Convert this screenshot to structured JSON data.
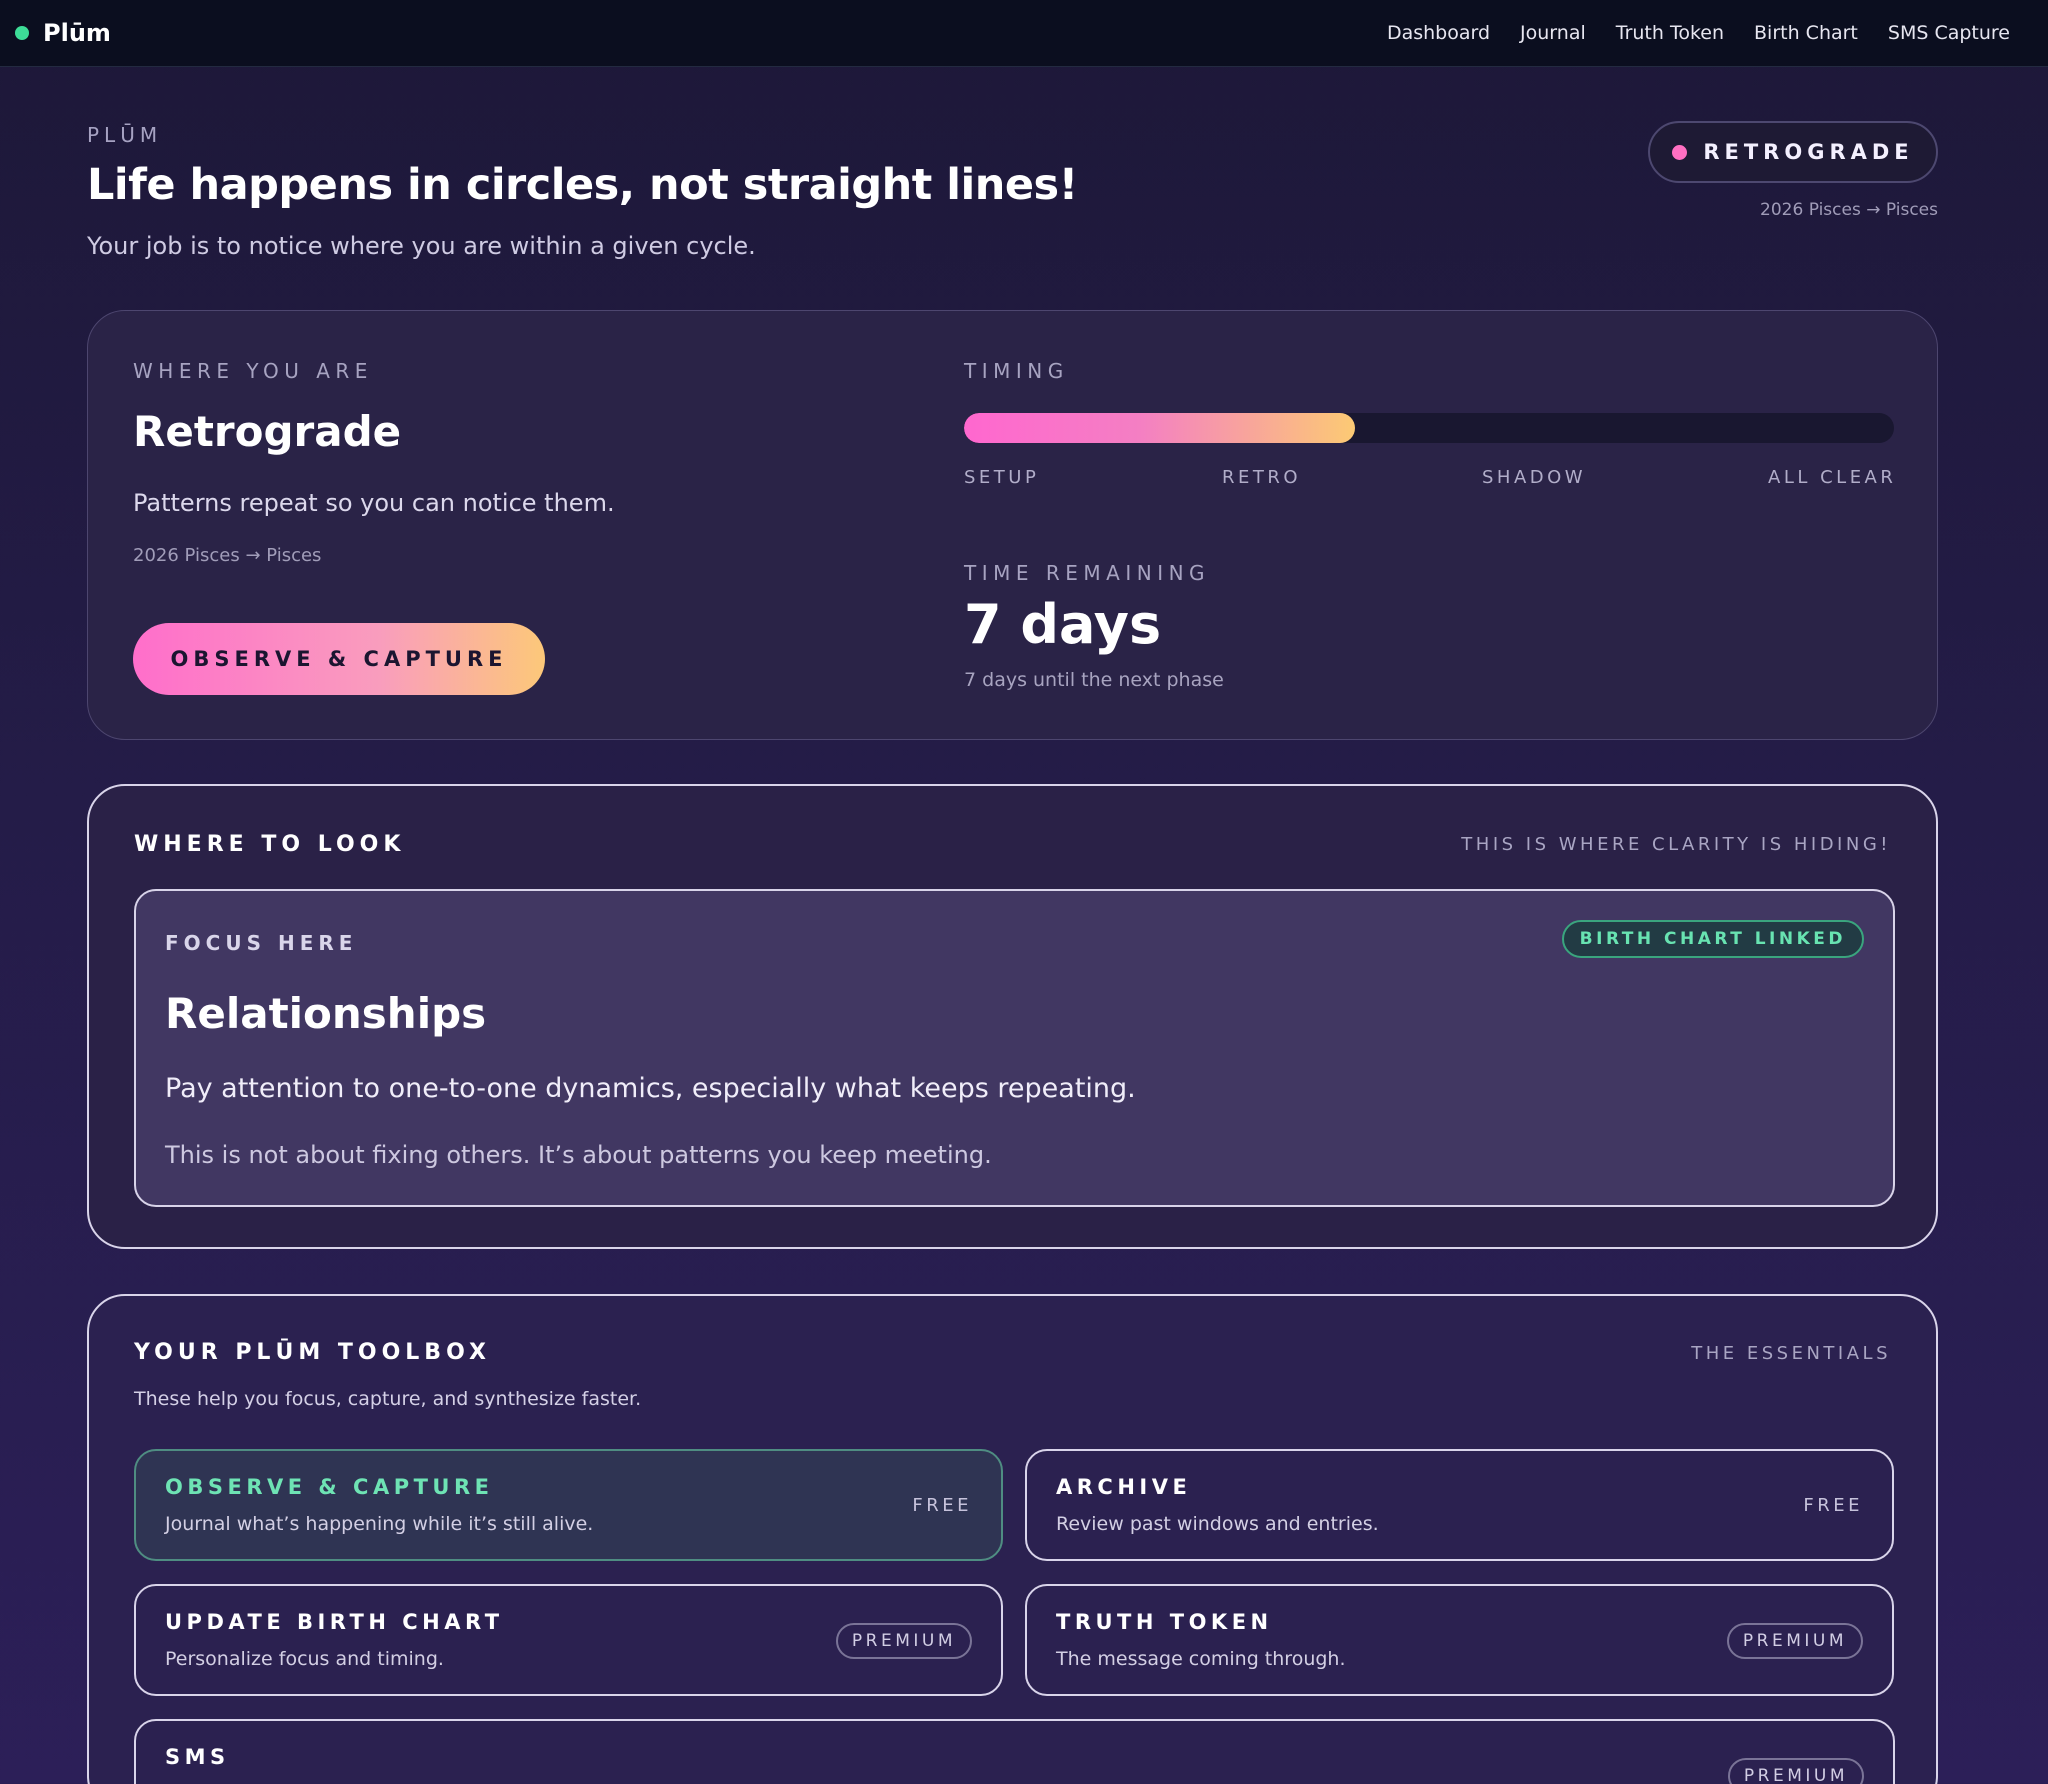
{
  "nav": {
    "brand": "Plūm",
    "links": [
      "Dashboard",
      "Journal",
      "Truth Token",
      "Birth Chart",
      "SMS Capture"
    ]
  },
  "hero": {
    "eyebrow": "PLŪM",
    "title": "Life happens in circles, not straight lines!",
    "subtitle": "Your job is to notice where you are within a given cycle.",
    "status_pill": "RETROGRADE",
    "status_sub": "2026 Pisces → Pisces"
  },
  "status": {
    "label": "WHERE YOU ARE",
    "title": "Retrograde",
    "description": "Patterns repeat so you can notice them.",
    "sub": "2026 Pisces → Pisces",
    "button": "OBSERVE & CAPTURE",
    "timing_label": "TIMING",
    "timing_progress_fraction": 0.42,
    "phases": [
      "SETUP",
      "RETRO",
      "SHADOW",
      "ALL CLEAR"
    ],
    "remaining_label": "TIME REMAINING",
    "remaining_value": "7 days",
    "remaining_sub": "7 days until the next phase"
  },
  "look": {
    "heading": "WHERE TO LOOK",
    "right_note": "THIS IS WHERE CLARITY IS HIDING!",
    "focus_label": "FOCUS HERE",
    "badge": "BIRTH CHART LINKED",
    "focus_title": "Relationships",
    "focus_desc": "Pay attention to one-to-one dynamics, especially what keeps repeating.",
    "focus_note": "This is not about fixing others. It’s about patterns you keep meeting."
  },
  "toolbox": {
    "heading": "YOUR PLŪM TOOLBOX",
    "right_note": "THE ESSENTIALS",
    "sub": "These help you focus, capture, and synthesize faster.",
    "tools": [
      {
        "name": "OBSERVE & CAPTURE",
        "desc": "Journal what’s happening while it’s still alive.",
        "tag": "FREE"
      },
      {
        "name": "ARCHIVE",
        "desc": "Review past windows and entries.",
        "tag": "FREE"
      },
      {
        "name": "UPDATE BIRTH CHART",
        "desc": "Personalize focus and timing.",
        "tag": "PREMIUM"
      },
      {
        "name": "TRUTH TOKEN",
        "desc": "The message coming through.",
        "tag": "PREMIUM"
      },
      {
        "name": "SMS",
        "desc": "",
        "tag": "PREMIUM"
      }
    ]
  },
  "colors": {
    "accent_green": "#3ddc97",
    "accent_pink": "#ff6fc2",
    "accent_gold": "#fcc879",
    "background": "#241c48"
  }
}
